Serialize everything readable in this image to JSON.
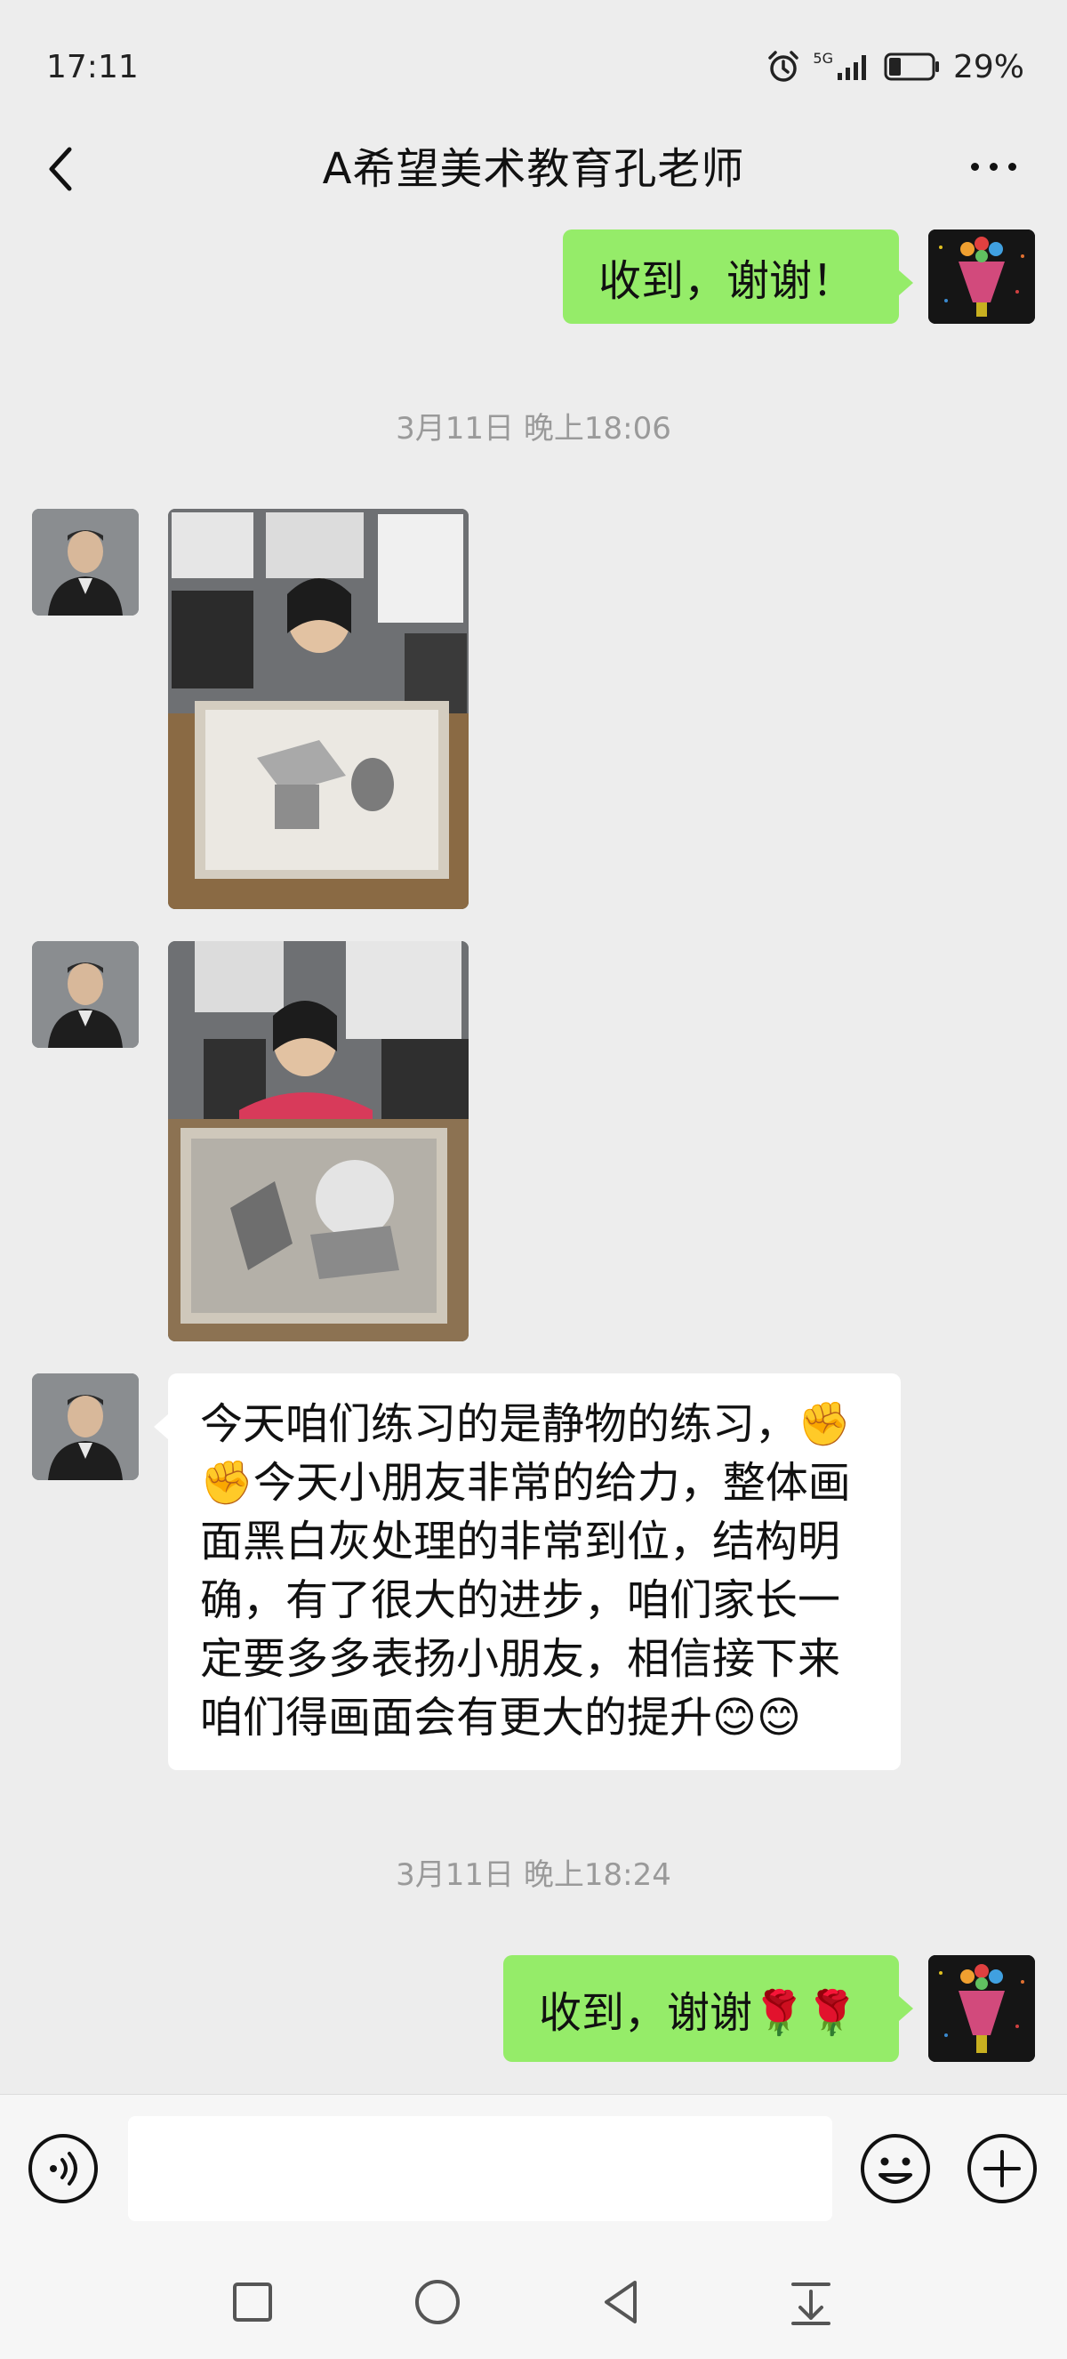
{
  "status_bar": {
    "time": "17:11",
    "network": "5G",
    "battery_percent": "29%",
    "battery_level": 0.29,
    "icons": [
      "alarm-icon",
      "signal-icon",
      "battery-icon"
    ]
  },
  "nav": {
    "title": "A希望美术教育孔老师",
    "back_icon": "chevron-left-icon",
    "more_icon": "more-dots-icon"
  },
  "messages": {
    "m1": {
      "sender": "me",
      "text": "收到，谢谢！"
    },
    "ts1": "3月11日 晚上18:06",
    "m2": {
      "sender": "teacher",
      "type": "image"
    },
    "m3": {
      "sender": "teacher",
      "type": "image"
    },
    "m4": {
      "sender": "teacher",
      "lines": [
        "今天咱们练习的是静物的练习，✊",
        "✊今天小朋友非常的给力，整体画",
        "面黑白灰处理的非常到位，结构明",
        "确，有了很大的进步，咱们家长一",
        "定要多多表扬小朋友，相信接下来",
        "咱们得画面会有更大的提升😊😊"
      ]
    },
    "ts2": "3月11日 晚上18:24",
    "m5": {
      "sender": "me",
      "text": "收到，谢谢🌹🌹"
    }
  },
  "input_bar": {
    "value": "",
    "icons": [
      "voice-icon",
      "emoji-icon",
      "plus-icon"
    ]
  },
  "system_nav": {
    "icons": [
      "recent-apps-icon",
      "home-icon",
      "back-icon",
      "notification-pull-icon"
    ]
  },
  "colors": {
    "background": "#ededed",
    "my_bubble": "#95ec69",
    "their_bubble": "#ffffff",
    "timestamp": "#9a9a9a"
  }
}
